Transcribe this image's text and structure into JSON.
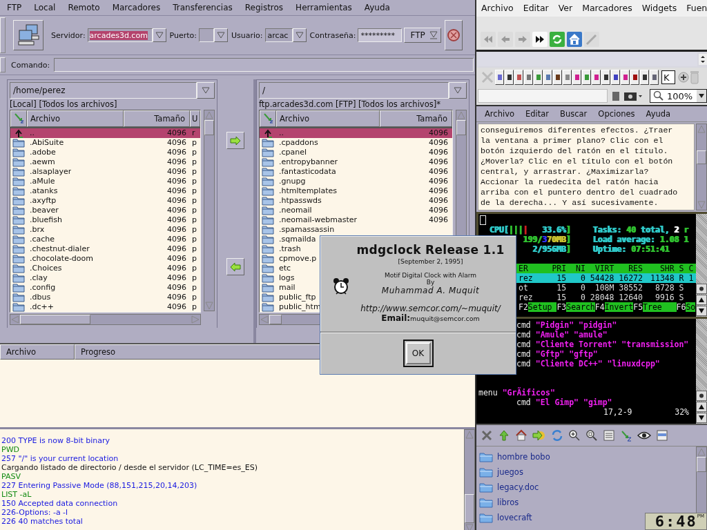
{
  "gftp": {
    "menu": [
      "FTP",
      "Local",
      "Remoto",
      "Marcadores",
      "Transferencias",
      "Registros",
      "Herramientas",
      "Ayuda"
    ],
    "connection": {
      "server_label": "Servidor:",
      "server": "arcades3d.com",
      "port_label": "Puerto:",
      "user_label": "Usuario:",
      "user": "arcac",
      "password_label": "Contraseña:",
      "password": "*********",
      "protocol": "FTP"
    },
    "command_label": "Comando:",
    "local": {
      "path": "/home/perez",
      "status": "[Local] [Todos los archivos]",
      "columns": [
        "Archivo",
        "Tamaño",
        "U"
      ],
      "rows": [
        {
          "kind": "up",
          "name": "..",
          "size": "4096",
          "extra": "r",
          "selected": true
        },
        {
          "kind": "folder",
          "name": ".AbiSuite",
          "size": "4096",
          "extra": "p",
          "selected": false
        },
        {
          "kind": "folder",
          "name": ".adobe",
          "size": "4096",
          "extra": "p",
          "selected": false
        },
        {
          "kind": "folder",
          "name": ".aewm",
          "size": "4096",
          "extra": "p",
          "selected": false
        },
        {
          "kind": "folder",
          "name": ".alsaplayer",
          "size": "4096",
          "extra": "p",
          "selected": false
        },
        {
          "kind": "folder",
          "name": ".aMule",
          "size": "4096",
          "extra": "p",
          "selected": false
        },
        {
          "kind": "folder",
          "name": ".atanks",
          "size": "4096",
          "extra": "p",
          "selected": false
        },
        {
          "kind": "folder",
          "name": ".axyftp",
          "size": "4096",
          "extra": "p",
          "selected": false
        },
        {
          "kind": "folder",
          "name": ".beaver",
          "size": "4096",
          "extra": "p",
          "selected": false
        },
        {
          "kind": "folder",
          "name": ".bluefish",
          "size": "4096",
          "extra": "p",
          "selected": false
        },
        {
          "kind": "folder",
          "name": ".brx",
          "size": "4096",
          "extra": "p",
          "selected": false
        },
        {
          "kind": "folder",
          "name": ".cache",
          "size": "4096",
          "extra": "p",
          "selected": false
        },
        {
          "kind": "folder",
          "name": ".chestnut-dialer",
          "size": "4096",
          "extra": "p",
          "selected": false
        },
        {
          "kind": "folder",
          "name": ".chocolate-doom",
          "size": "4096",
          "extra": "p",
          "selected": false
        },
        {
          "kind": "folder",
          "name": ".Choices",
          "size": "4096",
          "extra": "p",
          "selected": false
        },
        {
          "kind": "folder",
          "name": ".clay",
          "size": "4096",
          "extra": "p",
          "selected": false
        },
        {
          "kind": "folder",
          "name": ".config",
          "size": "4096",
          "extra": "p",
          "selected": false
        },
        {
          "kind": "folder",
          "name": ".dbus",
          "size": "4096",
          "extra": "p",
          "selected": false
        },
        {
          "kind": "folder",
          "name": ".dc++",
          "size": "4096",
          "extra": "p",
          "selected": false
        }
      ]
    },
    "remote": {
      "path": "/",
      "status": "ftp.arcades3d.com [FTP] [Todos los archivos]*",
      "columns": [
        "Archivo",
        "Tamaño"
      ],
      "rows": [
        {
          "kind": "up",
          "name": "..",
          "size": "4096",
          "selected": true
        },
        {
          "kind": "folder",
          "name": ".cpaddons",
          "size": "4096",
          "selected": false
        },
        {
          "kind": "folder",
          "name": ".cpanel",
          "size": "4096",
          "selected": false
        },
        {
          "kind": "folder",
          "name": ".entropybanner",
          "size": "4096",
          "selected": false
        },
        {
          "kind": "folder",
          "name": ".fantasticodata",
          "size": "4096",
          "selected": false
        },
        {
          "kind": "folder",
          "name": ".gnupg",
          "size": "4096",
          "selected": false
        },
        {
          "kind": "folder",
          "name": ".htmltemplates",
          "size": "4096",
          "selected": false
        },
        {
          "kind": "folder",
          "name": ".htpasswds",
          "size": "4096",
          "selected": false
        },
        {
          "kind": "folder",
          "name": ".neomail",
          "size": "4096",
          "selected": false
        },
        {
          "kind": "folder",
          "name": ".neomail-webmaster",
          "size": "4096",
          "selected": false
        },
        {
          "kind": "folder",
          "name": ".spamassassin",
          "selected": false
        },
        {
          "kind": "folder",
          "name": ".sqmailda",
          "selected": false
        },
        {
          "kind": "folder",
          "name": ".trash",
          "selected": false
        },
        {
          "kind": "folder",
          "name": "cpmove.p",
          "selected": false
        },
        {
          "kind": "folder",
          "name": "etc",
          "selected": false
        },
        {
          "kind": "folder",
          "name": "logs",
          "selected": false
        },
        {
          "kind": "folder",
          "name": "mail",
          "selected": false
        },
        {
          "kind": "folder",
          "name": "public_ftp",
          "selected": false
        },
        {
          "kind": "folder",
          "name": "public_htm",
          "selected": false
        }
      ]
    },
    "transfers": {
      "columns": [
        "Archivo",
        "Progreso"
      ]
    },
    "log": [
      {
        "kind": "response",
        "text": "200 TYPE is now 8-bit binary"
      },
      {
        "kind": "command",
        "text": "PWD"
      },
      {
        "kind": "response",
        "text": "257 \"/\" is your current location"
      },
      {
        "kind": "info",
        "text": "Cargando listado de directorio / desde el servidor (LC_TIME=es_ES)"
      },
      {
        "kind": "command",
        "text": "PASV"
      },
      {
        "kind": "response",
        "text": "227 Entering Passive Mode (88,151,215,20,14,203)"
      },
      {
        "kind": "command",
        "text": "LIST -aL"
      },
      {
        "kind": "response",
        "text": "150 Accepted data connection"
      },
      {
        "kind": "response",
        "text": "226-Options: -a -l"
      },
      {
        "kind": "response",
        "text": "226 40 matches total"
      }
    ]
  },
  "browser": {
    "menu": [
      "Archivo",
      "Editar",
      "Ver",
      "Marcadores",
      "Widgets",
      "Fuen"
    ],
    "field_text": "K",
    "zoom": "100%"
  },
  "editor": {
    "menu": [
      "Archivo",
      "Editar",
      "Buscar",
      "Opciones",
      "Ayuda"
    ],
    "text": "conseguiremos diferentes efectos. ¿Traer la ventana a primer plano? Clic con el botón izquierdo del ratón en el título. ¿Moverla? Clic en el título con el botón central, y arrastrar. ¿Maximizarla? Accionar la ruedecita del ratón hacia arriba con el puntero dentro del cuadrado de la derecha... Y así sucesivamente."
  },
  "htop": {
    "meters": [
      [
        {
          "text": "CPU[",
          "color": "#30c8c8"
        },
        {
          "text": "|||",
          "color": "#30c030"
        },
        {
          "text": "|",
          "color": "#d02020"
        },
        {
          "text": "   33.6%",
          "color": "#30c8c8"
        },
        {
          "text": "]",
          "color": "#30c030"
        }
      ],
      [
        {
          "text": "199/",
          "color": "#30c030"
        },
        {
          "text": "3",
          "color": "#3030f0"
        },
        {
          "text": "70MB",
          "color": "#c8c030"
        },
        {
          "text": "]",
          "color": "#30c030"
        }
      ],
      [
        {
          "text": "2/956MB",
          "color": "#30c8c8"
        },
        {
          "text": "]",
          "color": "#30c030"
        }
      ]
    ],
    "summary": [
      [
        {
          "text": "Tasks: ",
          "color": "#30c8c8"
        },
        {
          "text": "40",
          "color": "#30c030"
        },
        {
          "text": " total, ",
          "color": "#30c8c8"
        },
        {
          "text": "2",
          "color": "#ffffff"
        },
        {
          "text": " r",
          "color": "#30c030"
        }
      ],
      [
        {
          "text": "Load average: ",
          "color": "#30c8c8"
        },
        {
          "text": "1.08 1",
          "color": "#30c030"
        }
      ],
      [
        {
          "text": "Uptime: ",
          "color": "#30c8c8"
        },
        {
          "text": "07:51:41",
          "color": "#30c030"
        }
      ]
    ],
    "columns": [
      "ER",
      "PRI",
      "NI",
      "VIRT",
      "RES",
      "SHR",
      "S",
      "C"
    ],
    "processes": [
      {
        "cells": [
          "rez",
          "15",
          "0",
          "54428",
          "16272",
          "11348",
          "R",
          "1"
        ],
        "selected": true
      },
      {
        "cells": [
          "ot",
          "15",
          "0",
          "108M",
          "38552",
          "8728",
          "S"
        ],
        "selected": false
      },
      {
        "cells": [
          "rez",
          "15",
          "0",
          "28048",
          "12640",
          "9916",
          "S"
        ],
        "selected": false
      }
    ],
    "keys": [
      {
        "key": "F2",
        "label": "Setup"
      },
      {
        "key": "F3",
        "label": "Search"
      },
      {
        "key": "F4",
        "label": "Invert"
      },
      {
        "key": "F5",
        "label": "Tree"
      },
      {
        "key": "F6",
        "label": "So"
      }
    ]
  },
  "vim": {
    "items": [
      {
        "kind": "cmd",
        "keyword": "cmd",
        "args": "\"Pidgin\" \"pidgin\""
      },
      {
        "kind": "cmd",
        "keyword": "cmd",
        "args": "\"Amule\" \"amule\""
      },
      {
        "kind": "cmd",
        "keyword": "cmd",
        "args": "\"Cliente Torrent\" \"transmission\""
      },
      {
        "kind": "cmd",
        "keyword": "cmd",
        "args": "\"Gftp\" \"gftp\""
      },
      {
        "kind": "cmd",
        "keyword": "cmd",
        "args": "\"Cliente DC++\" \"linuxdcpp\""
      },
      {
        "kind": "menu",
        "keyword": "menu",
        "args": "\"GrÃificos\"",
        "children": [
          {
            "kind": "cmd",
            "keyword": "cmd",
            "args": "\"El Gimp\" \"gimp\""
          }
        ]
      }
    ],
    "position": "17,2-9",
    "percent": "32%"
  },
  "filemanager": {
    "items": [
      {
        "name": "hombre bobo",
        "selected": false
      },
      {
        "name": "juegos",
        "selected": false
      },
      {
        "name": "legacy.doc",
        "selected": false
      },
      {
        "name": "libros",
        "selected": false
      },
      {
        "name": "lovecraft",
        "selected": false
      }
    ]
  },
  "dialog": {
    "title": "mdgclock Release 1.1",
    "date": "[September 2, 1995]",
    "description": "Motif Digital Clock with Alarm",
    "by": "By",
    "author": "Muhammad A. Muquit",
    "url": "http://www.semcor.com/~muquit/",
    "email_label": "Email:",
    "email": "muquit@semcor.com",
    "button": "OK"
  },
  "clock": {
    "time": "6:48",
    "period": "PM"
  }
}
